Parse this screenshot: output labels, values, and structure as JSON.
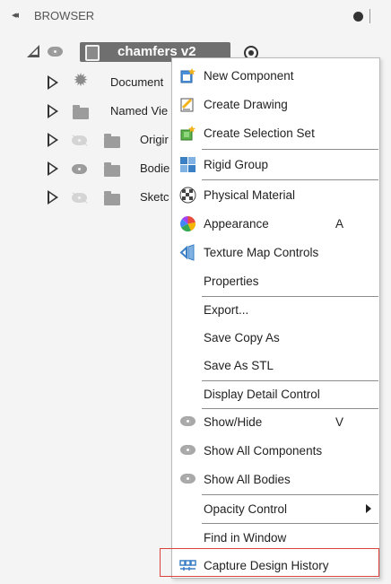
{
  "browser": {
    "collapse_glyph": "◂◂",
    "title": "BROWSER"
  },
  "tree": {
    "root": {
      "name": "chamfers v2"
    },
    "children": [
      {
        "label": "Document",
        "icon": "gear-icon",
        "visible_eye": false
      },
      {
        "label": "Named Vie",
        "icon": "folder-icon",
        "visible_eye": false
      },
      {
        "label": "Origir",
        "icon": "folder-icon",
        "visible_eye": "hidden"
      },
      {
        "label": "Bodie",
        "icon": "folder-icon",
        "visible_eye": "shown"
      },
      {
        "label": "Sketc",
        "icon": "folder-icon",
        "visible_eye": "hidden"
      }
    ]
  },
  "context_menu": {
    "items": [
      {
        "label": "New Component",
        "icon": "new-component-icon"
      },
      {
        "label": "Create Drawing",
        "icon": "create-drawing-icon"
      },
      {
        "label": "Create Selection Set",
        "icon": "selection-set-icon"
      },
      {
        "label": "Rigid Group",
        "icon": "rigid-group-icon"
      },
      {
        "label": "Physical Material",
        "icon": "physical-material-icon"
      },
      {
        "label": "Appearance",
        "icon": "appearance-icon",
        "shortcut": "A"
      },
      {
        "label": "Texture Map Controls",
        "icon": "texture-map-icon"
      },
      {
        "label": "Properties"
      },
      {
        "label": "Export..."
      },
      {
        "label": "Save Copy As"
      },
      {
        "label": "Save As STL"
      },
      {
        "label": "Display Detail Control"
      },
      {
        "label": "Show/Hide",
        "icon": "eye-icon",
        "shortcut": "V"
      },
      {
        "label": "Show All Components",
        "icon": "eye-icon"
      },
      {
        "label": "Show All Bodies",
        "icon": "eye-icon"
      },
      {
        "label": "Opacity Control",
        "submenu": true
      },
      {
        "label": "Find in Window"
      },
      {
        "label": "Capture Design History",
        "icon": "capture-history-icon"
      }
    ]
  },
  "colors": {
    "highlight_border": "#d9423d",
    "root_pill": "#6f6f6f",
    "menu_bg": "#ffffff"
  }
}
